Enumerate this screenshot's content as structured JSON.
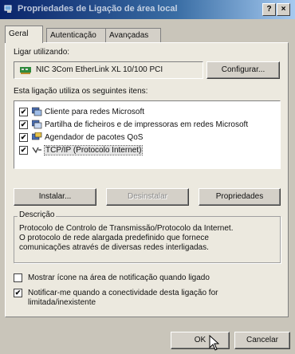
{
  "window": {
    "title": "Propriedades de Ligação de área local",
    "help_btn": "?",
    "close_btn": "×"
  },
  "tabs": [
    {
      "label": "Geral",
      "active": true
    },
    {
      "label": "Autenticação",
      "active": false
    },
    {
      "label": "Avançadas",
      "active": false
    }
  ],
  "connect_using": {
    "label": "Ligar utilizando:",
    "adapter": "NIC 3Com EtherLink XL 10/100 PCI",
    "configure_btn": "Configurar..."
  },
  "components": {
    "label": "Esta ligação utiliza os seguintes itens:",
    "items": [
      {
        "label": "Cliente para redes Microsoft",
        "checked": true,
        "icon": "network-client-icon"
      },
      {
        "label": "Partilha de ficheiros e de impressoras em redes Microsoft",
        "checked": true,
        "icon": "file-printer-sharing-icon"
      },
      {
        "label": "Agendador de pacotes QoS",
        "checked": true,
        "icon": "qos-scheduler-icon"
      },
      {
        "label": "TCP/IP (Protocolo Internet)",
        "checked": true,
        "icon": "protocol-icon",
        "selected": true
      }
    ]
  },
  "buttons": {
    "install": "Instalar...",
    "uninstall": "Desinstalar",
    "properties": "Propriedades"
  },
  "description": {
    "title": "Descrição",
    "lines": [
      "Protocolo de Controlo de Transmissão/Protocolo da Internet.",
      "O protocolo de rede alargada predefinido que fornece",
      "comunicações através de diversas redes interligadas."
    ]
  },
  "options": {
    "show_icon": {
      "label": "Mostrar ícone na área de notificação quando ligado",
      "checked": false
    },
    "notify": {
      "line1": "Notificar-me quando a conectividade desta ligação for",
      "line2": "limitada/inexistente",
      "checked": true
    }
  },
  "footer": {
    "ok": "OK",
    "cancel": "Cancelar"
  },
  "colors": {
    "titlebar_start": "#0a246a",
    "face": "#ece9df"
  }
}
